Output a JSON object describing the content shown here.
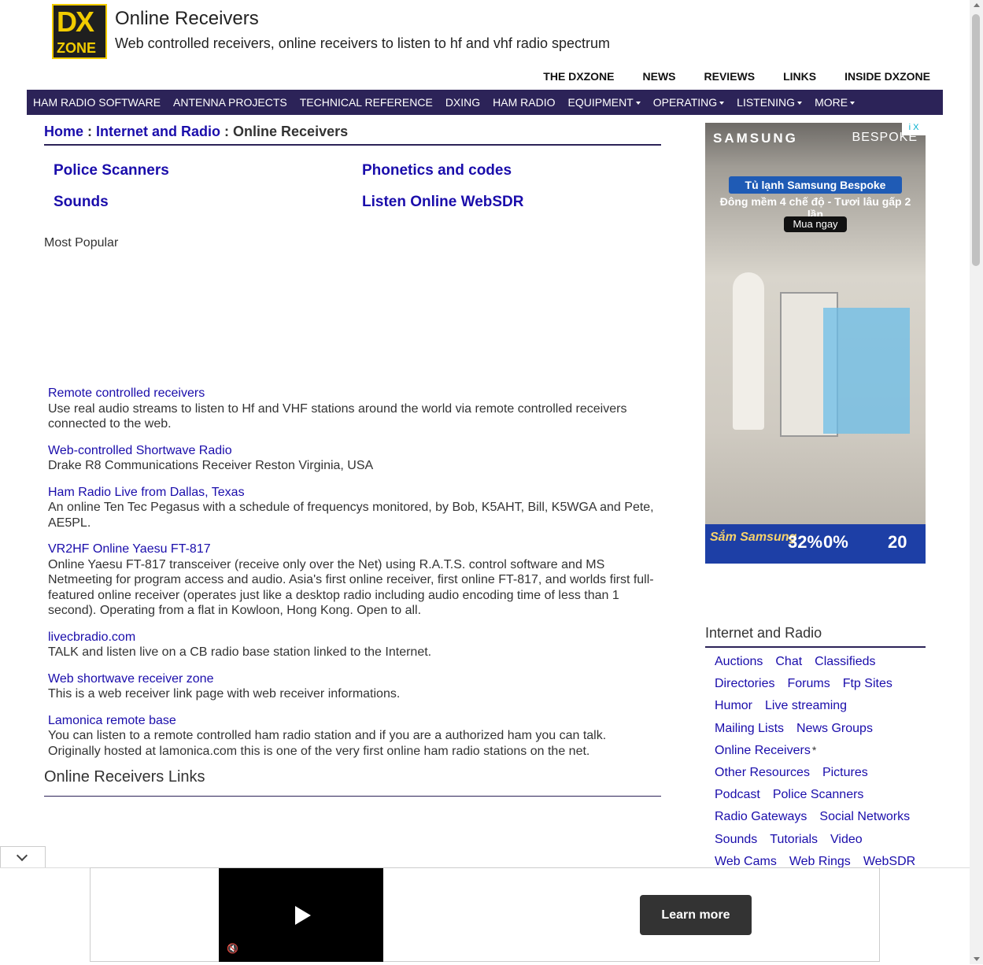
{
  "header": {
    "logo_top": "DX",
    "logo_bottom": "ZONE",
    "title": "Online Receivers",
    "subtitle": "Web controlled receivers, online receivers to listen to hf and vhf radio spectrum"
  },
  "topnav": [
    "THE DXZONE",
    "NEWS",
    "REVIEWS",
    "LINKS",
    "INSIDE DXZONE"
  ],
  "mainnav": [
    {
      "label": "HAM RADIO SOFTWARE",
      "dropdown": false
    },
    {
      "label": "ANTENNA PROJECTS",
      "dropdown": false
    },
    {
      "label": "TECHNICAL REFERENCE",
      "dropdown": false
    },
    {
      "label": "DXING",
      "dropdown": false
    },
    {
      "label": "HAM RADIO",
      "dropdown": false
    },
    {
      "label": "EQUIPMENT",
      "dropdown": true
    },
    {
      "label": "OPERATING",
      "dropdown": true
    },
    {
      "label": "LISTENING",
      "dropdown": true
    },
    {
      "label": "MORE",
      "dropdown": true
    }
  ],
  "breadcrumb": {
    "home": "Home",
    "sep1": " : ",
    "parent": "Internet and Radio",
    "sep2": " : ",
    "current": "Online Receivers"
  },
  "categories": [
    "Police Scanners",
    "Phonetics and codes",
    "Sounds",
    "Listen Online WebSDR"
  ],
  "most_popular": "Most Popular",
  "links": [
    {
      "title": "Remote controlled receivers",
      "desc": "Use real audio streams to listen to Hf and VHF stations around the world via remote controlled receivers connected to the web."
    },
    {
      "title": "Web-controlled Shortwave Radio",
      "desc": "Drake R8 Communications Receiver Reston Virginia, USA"
    },
    {
      "title": "Ham Radio Live from Dallas, Texas",
      "desc": "An online Ten Tec Pegasus with a schedule of frequencys monitored, by Bob, K5AHT, Bill, K5WGA and Pete, AE5PL."
    },
    {
      "title": "VR2HF Online Yaesu FT-817",
      "desc": "Online Yaesu FT-817 transceiver (receive only over the Net) using R.A.T.S. control software and MS Netmeeting for program access and audio. Asia's first online receiver, first online FT-817, and worlds first full-featured online receiver (operates just like a desktop radio including audio encoding time of less than 1 second). Operating from a flat in Kowloon, Hong Kong. Open to all."
    },
    {
      "title": "livecbradio.com",
      "desc": "TALK and listen live on a CB radio base station linked to the Internet."
    },
    {
      "title": "Web shortwave receiver zone",
      "desc": "This is a web receiver link page with web receiver informations."
    },
    {
      "title": "Lamonica remote base",
      "desc": "You can listen to a remote controlled ham radio station and if you are a authorized ham you can talk. Originally hosted at lamonica.com this is one of the very first online ham radio stations on the net."
    }
  ],
  "section_heading": "Online Receivers Links",
  "ad": {
    "brand": "SAMSUNG",
    "brand2": "BESPOKE",
    "info": "i X",
    "headline": "Tủ lạnh Samsung Bespoke",
    "subline": "Đông mềm 4 chế độ - Tươi lâu gấp 2 lần",
    "cta": "Mua ngay",
    "footer_brand": "Sắm Samsung",
    "offer1": "32%",
    "offer2": "0%",
    "offer3": "20"
  },
  "sidebar": {
    "title": "Internet and Radio",
    "rows": [
      [
        "Auctions",
        "Chat",
        "Classifieds"
      ],
      [
        "Directories",
        "Forums",
        "Ftp Sites"
      ],
      [
        "Humor",
        "Live streaming"
      ],
      [
        "Mailing Lists",
        "News Groups"
      ],
      [
        "Online Receivers"
      ],
      [
        "Other Resources",
        "Pictures"
      ],
      [
        "Podcast",
        "Police Scanners"
      ],
      [
        "Radio Gateways",
        "Social Networks"
      ],
      [
        "Sounds",
        "Tutorials",
        "Video"
      ],
      [
        "Web Cams",
        "Web Rings",
        "WebSDR"
      ]
    ],
    "current_marker": "*"
  },
  "anchor_ad": {
    "cta": "Learn more"
  },
  "colors": {
    "nav_bg": "#2c2358",
    "link": "#1a0dab",
    "logo_yellow": "#f2cc00"
  }
}
